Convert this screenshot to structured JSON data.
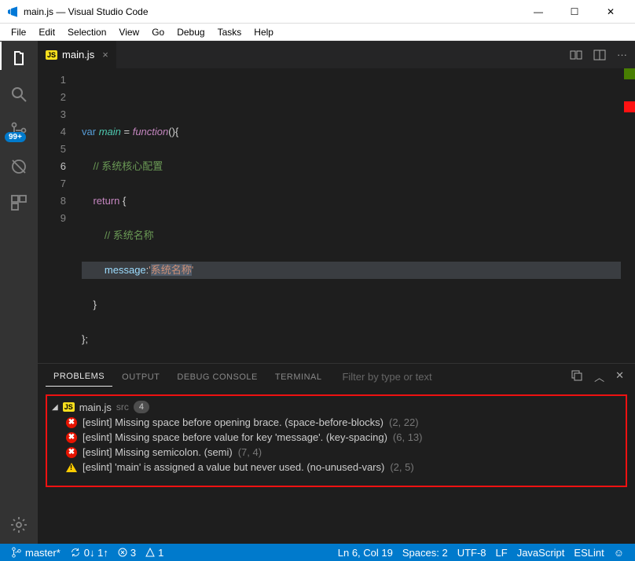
{
  "window": {
    "title": "main.js — Visual Studio Code"
  },
  "menu": [
    "File",
    "Edit",
    "Selection",
    "View",
    "Go",
    "Debug",
    "Tasks",
    "Help"
  ],
  "activity_badge": "99+",
  "tabs": [
    {
      "icon": "JS",
      "label": "main.js"
    }
  ],
  "code": {
    "lines": [
      "1",
      "2",
      "3",
      "4",
      "5",
      "6",
      "7",
      "8",
      "9"
    ],
    "l2_var": "var",
    "l2_main": "main",
    "l2_eq": " = ",
    "l2_fn": "function",
    "l2_paren": "(){",
    "l3_cm": "// 系统核心配置",
    "l4_ret": "return",
    "l4_brace": " {",
    "l5_cm": "// 系统名称",
    "l6_prop": "message",
    "l6_colon": ":",
    "l6_q1": "'",
    "l6_str": "系统名称",
    "l6_q2": "'",
    "l7": "}",
    "l8": "};"
  },
  "panel": {
    "tabs": [
      "PROBLEMS",
      "OUTPUT",
      "DEBUG CONSOLE",
      "TERMINAL"
    ],
    "filter_placeholder": "Filter by type or text",
    "file_label": "main.js",
    "file_src": "src",
    "file_count": "4",
    "items": [
      {
        "sev": "error",
        "text": "[eslint] Missing space before opening brace. (space-before-blocks)",
        "loc": "(2, 22)"
      },
      {
        "sev": "error",
        "text": "[eslint] Missing space before value for key 'message'. (key-spacing)",
        "loc": "(6, 13)"
      },
      {
        "sev": "error",
        "text": "[eslint] Missing semicolon. (semi)",
        "loc": "(7, 4)"
      },
      {
        "sev": "warn",
        "text": "[eslint] 'main' is assigned a value but never used. (no-unused-vars)",
        "loc": "(2, 5)"
      }
    ]
  },
  "status": {
    "branch": "master*",
    "sync": "0↓ 1↑",
    "err": "3",
    "warn": "1",
    "cursor": "Ln 6, Col 19",
    "spaces": "Spaces: 2",
    "enc": "UTF-8",
    "eol": "LF",
    "lang": "JavaScript",
    "linter": "ESLint"
  }
}
